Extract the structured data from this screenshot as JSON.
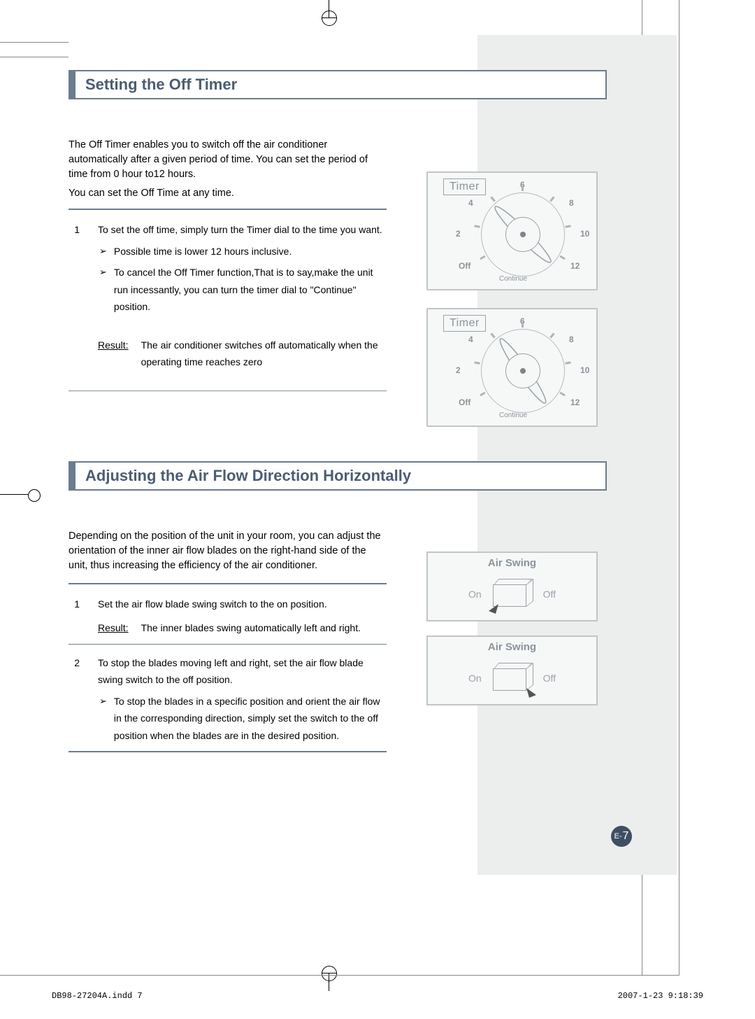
{
  "section1": {
    "heading": "Setting the Off Timer",
    "intro": "The Off Timer enables you to switch off the air conditioner automatically after a given period of time. You can set the period of time from 0 hour to12 hours.",
    "sub_intro": "You can set the Off Time at any time.",
    "step1_num": "1",
    "step1_text": "To set the off time, simply turn the Timer dial to the time you want.",
    "bullet1": "Possible time is lower 12 hours inclusive.",
    "bullet2": "To cancel the Off  Timer function,That is to say,make the unit run incessantly, you can turn the timer dial to \"Continue\" position.",
    "result_label": "Result:",
    "result_text": "The air conditioner switches off automatically when the operating time reaches zero"
  },
  "section2": {
    "heading": "Adjusting the Air Flow Direction Horizontally",
    "intro": "Depending on the position of the unit in your room, you can adjust the orientation of the inner air flow blades on the right-hand side of the unit, thus increasing the efficiency of the air conditioner.",
    "step1_num": "1",
    "step1_text": "Set the air flow blade swing switch to the on position.",
    "result_label": "Result:",
    "result_text": "The inner blades swing automatically left and right.",
    "step2_num": "2",
    "step2_text": "To stop the blades moving left and right, set the air flow blade swing switch to the off position.",
    "bullet1": "To stop the blades in a specific position and orient the air flow in the corresponding direction, simply set the switch to the off position when the blades are in the desired position."
  },
  "dial": {
    "label": "Timer",
    "t2": "2",
    "t4": "4",
    "t6": "6",
    "t8": "8",
    "t10": "10",
    "t12": "12",
    "off": "Off",
    "continue": "Continue"
  },
  "swing": {
    "title": "Air Swing",
    "on": "On",
    "off": "Off"
  },
  "page_num_prefix": "E-",
  "page_num": "7",
  "footer_left": "DB98-27204A.indd   7",
  "footer_right": "2007-1-23   9:18:39"
}
